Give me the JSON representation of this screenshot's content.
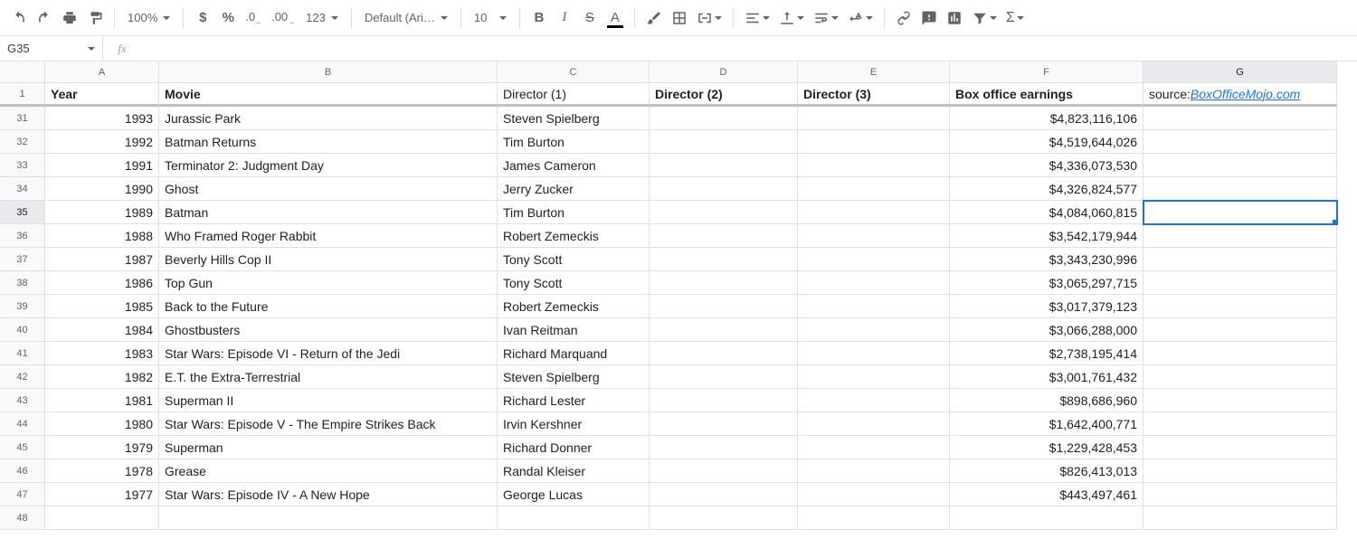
{
  "toolbar": {
    "zoom": "100%",
    "font": "Default (Ari…",
    "font_size": "10",
    "number_fmt": "123"
  },
  "name_box": "G35",
  "fx": "fx",
  "columns": [
    "A",
    "B",
    "C",
    "D",
    "E",
    "F",
    "G"
  ],
  "selected_col": "G",
  "selected_row": "35",
  "header_row": {
    "row_num": "1",
    "year": "Year",
    "movie": "Movie",
    "d1": "Director (1)",
    "d2": "Director (2)",
    "d3": "Director (3)",
    "box": "Box office earnings",
    "src_prefix": "source: ",
    "src_link": "BoxOfficeMojo.com"
  },
  "rows": [
    {
      "n": "31",
      "y": "1993",
      "m": "Jurassic Park",
      "d": "Steven Spielberg",
      "b": "$4,823,116,106"
    },
    {
      "n": "32",
      "y": "1992",
      "m": "Batman Returns",
      "d": "Tim Burton",
      "b": "$4,519,644,026"
    },
    {
      "n": "33",
      "y": "1991",
      "m": "Terminator 2: Judgment Day",
      "d": "James Cameron",
      "b": "$4,336,073,530"
    },
    {
      "n": "34",
      "y": "1990",
      "m": "Ghost",
      "d": "Jerry Zucker",
      "b": "$4,326,824,577"
    },
    {
      "n": "35",
      "y": "1989",
      "m": "Batman",
      "d": "Tim Burton",
      "b": "$4,084,060,815"
    },
    {
      "n": "36",
      "y": "1988",
      "m": "Who Framed Roger Rabbit",
      "d": "Robert Zemeckis",
      "b": "$3,542,179,944"
    },
    {
      "n": "37",
      "y": "1987",
      "m": "Beverly Hills Cop II",
      "d": "Tony Scott",
      "b": "$3,343,230,996"
    },
    {
      "n": "38",
      "y": "1986",
      "m": "Top Gun",
      "d": "Tony Scott",
      "b": "$3,065,297,715"
    },
    {
      "n": "39",
      "y": "1985",
      "m": "Back to the Future",
      "d": "Robert Zemeckis",
      "b": "$3,017,379,123"
    },
    {
      "n": "40",
      "y": "1984",
      "m": "Ghostbusters",
      "d": "Ivan Reitman",
      "b": "$3,066,288,000"
    },
    {
      "n": "41",
      "y": "1983",
      "m": "Star Wars: Episode VI - Return of the Jedi",
      "d": "Richard Marquand",
      "b": "$2,738,195,414"
    },
    {
      "n": "42",
      "y": "1982",
      "m": "E.T. the Extra-Terrestrial",
      "d": "Steven Spielberg",
      "b": "$3,001,761,432"
    },
    {
      "n": "43",
      "y": "1981",
      "m": "Superman II",
      "d": "Richard Lester",
      "b": "$898,686,960"
    },
    {
      "n": "44",
      "y": "1980",
      "m": "Star Wars: Episode V - The Empire Strikes Back",
      "d": "Irvin Kershner",
      "b": "$1,642,400,771"
    },
    {
      "n": "45",
      "y": "1979",
      "m": "Superman",
      "d": "Richard Donner",
      "b": "$1,229,428,453"
    },
    {
      "n": "46",
      "y": "1978",
      "m": "Grease",
      "d": "Randal Kleiser",
      "b": "$826,413,013"
    },
    {
      "n": "47",
      "y": "1977",
      "m": "Star Wars: Episode IV - A New Hope",
      "d": "George Lucas",
      "b": "$443,497,461"
    },
    {
      "n": "48",
      "y": "",
      "m": "",
      "d": "",
      "b": ""
    }
  ]
}
